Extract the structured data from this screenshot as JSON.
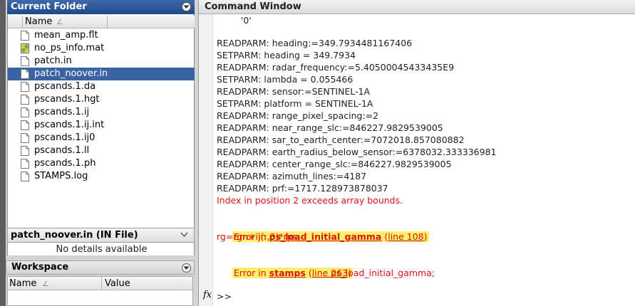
{
  "current_folder": {
    "title": "Current Folder",
    "column_name": "Name",
    "sort_indicator": "∠",
    "files": [
      {
        "name": "mean_amp.flt",
        "icon": "file-icon",
        "selected": false
      },
      {
        "name": "no_ps_info.mat",
        "icon": "mat-file-icon",
        "selected": false
      },
      {
        "name": "patch.in",
        "icon": "file-icon",
        "selected": false
      },
      {
        "name": "patch_noover.in",
        "icon": "file-icon",
        "selected": true
      },
      {
        "name": "pscands.1.da",
        "icon": "file-icon",
        "selected": false
      },
      {
        "name": "pscands.1.hgt",
        "icon": "file-icon",
        "selected": false
      },
      {
        "name": "pscands.1.ij",
        "icon": "file-icon",
        "selected": false
      },
      {
        "name": "pscands.1.ij.int",
        "icon": "file-icon",
        "selected": false
      },
      {
        "name": "pscands.1.ij0",
        "icon": "file-icon",
        "selected": false
      },
      {
        "name": "pscands.1.ll",
        "icon": "file-icon",
        "selected": false
      },
      {
        "name": "pscands.1.ph",
        "icon": "file-icon",
        "selected": false
      },
      {
        "name": "STAMPS.log",
        "icon": "file-icon",
        "selected": false
      }
    ]
  },
  "details": {
    "title": "patch_noover.in  (IN File)",
    "body": "No details available"
  },
  "workspace": {
    "title": "Workspace",
    "col_name": "Name",
    "col_value": "Value",
    "sort_indicator": "∠"
  },
  "command_window": {
    "title": "Command Window",
    "lines": {
      "l0": "'0'",
      "l1": "READPARM: heading:=349.7934481167406",
      "l2": "SETPARM: heading = 349.7934",
      "l3": "READPARM: radar_frequency:=5.40500045433435E9",
      "l4": "SETPARM: lambda = 0.055466",
      "l5": "READPARM: sensor:=SENTINEL-1A",
      "l6": "SETPARM: platform = SENTINEL-1A",
      "l7": "READPARM: range_pixel_spacing:=2",
      "l8": "READPARM: near_range_slc:=846227.9829539005",
      "l9": "READPARM: sar_to_earth_center:=7072018.857080882",
      "l10": "READPARM: earth_radius_below_sensor:=6378032.333336981",
      "l11": "READPARM: center_range_slc:=846227.9829539005",
      "l12": "READPARM: azimuth_lines:=4187",
      "l13": "READPARM: prf:=1717.128973878037",
      "err1": "Index in position 2 exceeds array bounds."
    },
    "error1": {
      "prefix": "Error in ",
      "func": "ps_load_initial_gamma",
      "open": " (",
      "line": "line 108",
      "close": ")",
      "code": "rg=rgn+ij(:,3)*rps;"
    },
    "error2": {
      "prefix": "Error in ",
      "func": "stamps",
      "open": " (",
      "line": "line 263",
      "close": ")",
      "code": "ps_load_initial_gamma;"
    },
    "fx_label": "fx",
    "prompt": ">>"
  },
  "colors": {
    "selection": "#3b62a4",
    "error_text": "#d81414",
    "highlight": "#fff06a",
    "panel_header": "#1f4a8a"
  }
}
